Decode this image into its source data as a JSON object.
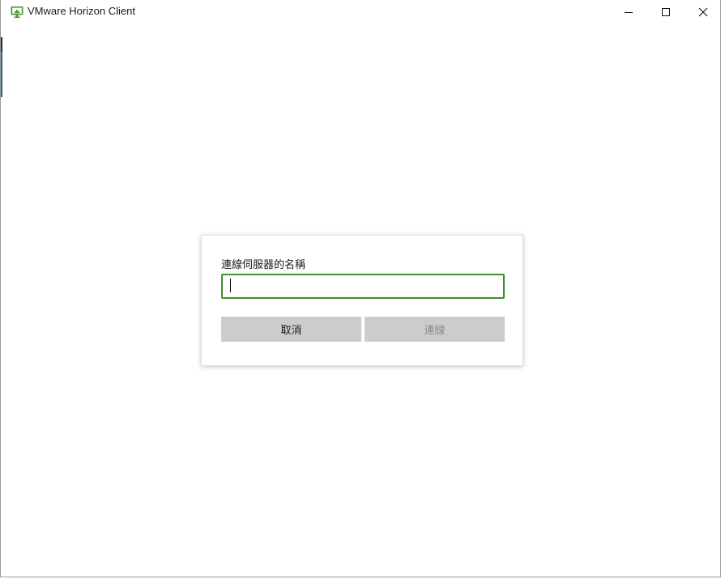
{
  "window": {
    "title": "VMware Horizon Client",
    "icon": "vmware-horizon-monitor-icon",
    "controls": {
      "minimize_icon": "minimize-icon",
      "maximize_icon": "maximize-icon",
      "close_icon": "close-icon"
    }
  },
  "dialog": {
    "label": "連線伺服器的名稱",
    "server_input": {
      "value": "",
      "placeholder": ""
    },
    "cancel_label": "取消",
    "connect_label": "連線"
  },
  "colors": {
    "brand_green": "#3f8f2a",
    "button_gray": "#cccccc",
    "disabled_text": "#8c8c8c"
  }
}
